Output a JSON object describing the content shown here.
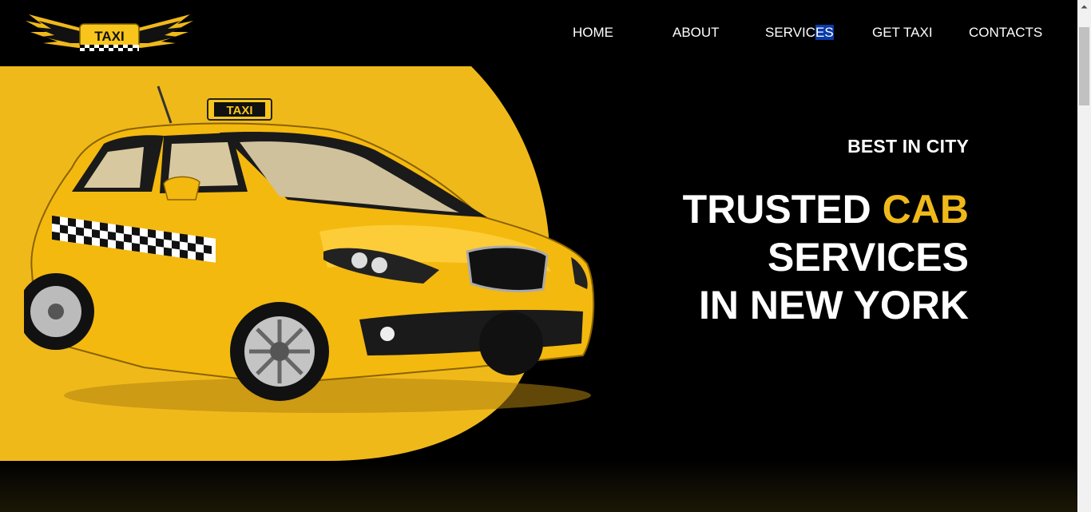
{
  "brand": {
    "logo_text": "TAXI"
  },
  "nav": {
    "home": "HOME",
    "about": "ABOUT",
    "services_a": "SERVIC",
    "services_b": "ES",
    "get_taxi": "GET TAXI",
    "contacts": "CONTACTS"
  },
  "hero": {
    "tagline": "BEST IN CITY",
    "headline_word1": "TRUSTED",
    "headline_accent": "CAB",
    "headline_line2": "SERVICES",
    "headline_line3": "IN NEW YORK",
    "car_roof_sign": "TAXI"
  },
  "colors": {
    "background": "#000000",
    "accent_yellow": "#f0b91a",
    "text_white": "#ffffff",
    "selection_blue": "#0a3aa8"
  }
}
